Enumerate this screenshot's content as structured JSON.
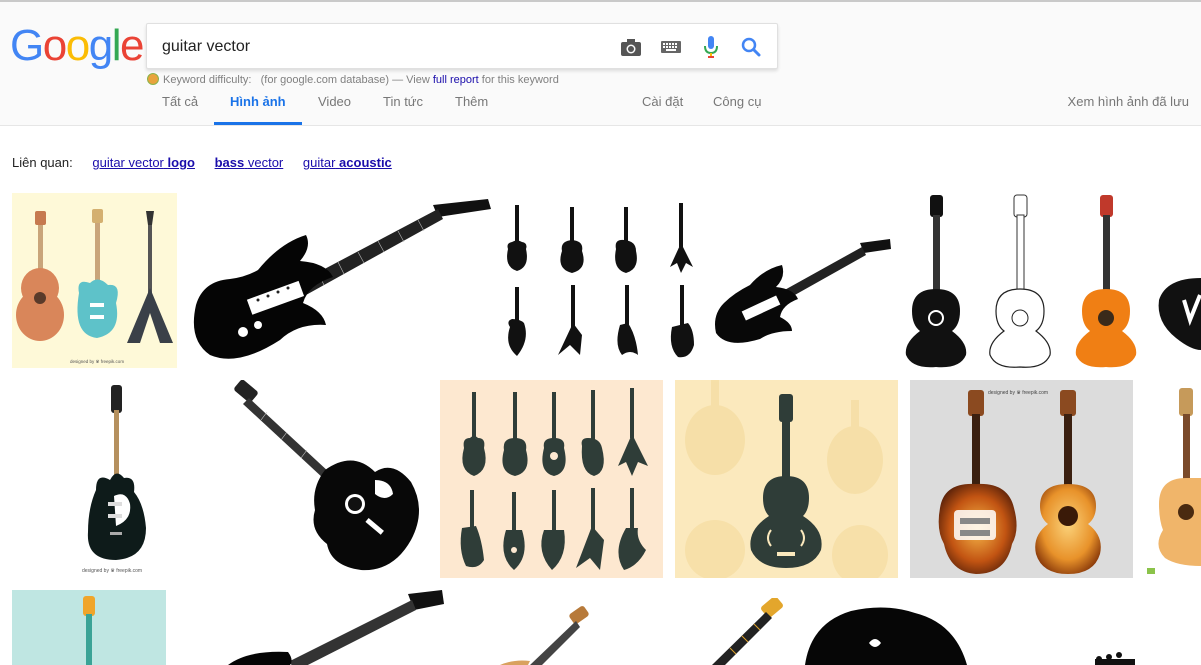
{
  "logo": "Google",
  "search": {
    "query": "guitar vector"
  },
  "keyword_bar": {
    "label": "Keyword difficulty:",
    "text_before": "(for google.com database) — View",
    "link": "full report",
    "text_after": "for this keyword"
  },
  "tabs": [
    {
      "label": "Tất cả",
      "active": false
    },
    {
      "label": "Hình ảnh",
      "active": true
    },
    {
      "label": "Video",
      "active": false
    },
    {
      "label": "Tin tức",
      "active": false
    },
    {
      "label": "Thêm",
      "active": false
    }
  ],
  "tools": {
    "settings": "Cài đặt",
    "tools": "Công cụ"
  },
  "saved_images": "Xem hình ảnh đã lưu",
  "related": {
    "label": "Liên quan:",
    "items": [
      {
        "prefix": "guitar vector",
        "bold": "logo"
      },
      {
        "prefix": "",
        "bold": "bass",
        "suffix": "vector"
      },
      {
        "prefix": "guitar",
        "bold": "acoustic"
      }
    ]
  },
  "credits": {
    "freepik1": "designed by ♛ freepik.com",
    "freepik2": "designed by ♛ freepik.com",
    "freepik3": "designed by ♛ freepik.com"
  },
  "colors": {
    "accent": "#1a73e8",
    "link": "#1a0dab"
  }
}
